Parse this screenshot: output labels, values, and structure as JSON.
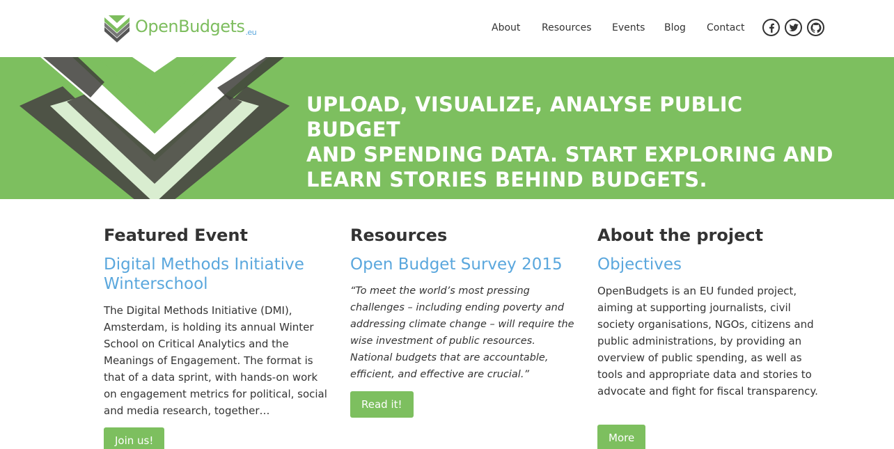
{
  "brand": {
    "name": "OpenBudgets",
    "suffix": ".eu"
  },
  "nav": {
    "items": [
      "About",
      "Resources",
      "Events",
      "Blog",
      "Contact"
    ]
  },
  "social": {
    "icons": [
      "facebook-icon",
      "twitter-icon",
      "github-icon"
    ]
  },
  "colors": {
    "green": "#7dbf5f",
    "blue": "#5aa7dd",
    "dark": "#333333"
  },
  "hero": {
    "line1": "UPLOAD, VISUALIZE, ANALYSE PUBLIC BUDGET",
    "line2": "AND SPENDING DATA. START EXPLORING AND",
    "line3": "LEARN STORIES BEHIND BUDGETS."
  },
  "featured": {
    "heading": "Featured Event",
    "title": "Digital Methods Initiative Winterschool",
    "body": "The Digital Methods Initiative (DMI), Amsterdam, is holding its annual Winter School on Critical Analytics and the Meanings of Engagement. The format is that of a data sprint, with hands-on work on engagement metrics for political, social and media research, together…",
    "button": "Join us!"
  },
  "resources": {
    "heading": "Resources",
    "title": "Open Budget Survey 2015",
    "body": "“To meet the world’s most pressing challenges – including ending poverty and addressing climate change – will require the wise investment of public resources. National budgets that are accountable, efficient, and effective are crucial.”",
    "button": "Read it!"
  },
  "about": {
    "heading": "About the project",
    "title": "Objectives",
    "body": "OpenBudgets is an EU funded project, aiming at supporting journalists, civil society organisations, NGOs, citizens and public administrations, by providing an overview of public spending, as well as tools and appropriate data and stories to advocate and fight for fiscal transparency.",
    "button": "More"
  }
}
